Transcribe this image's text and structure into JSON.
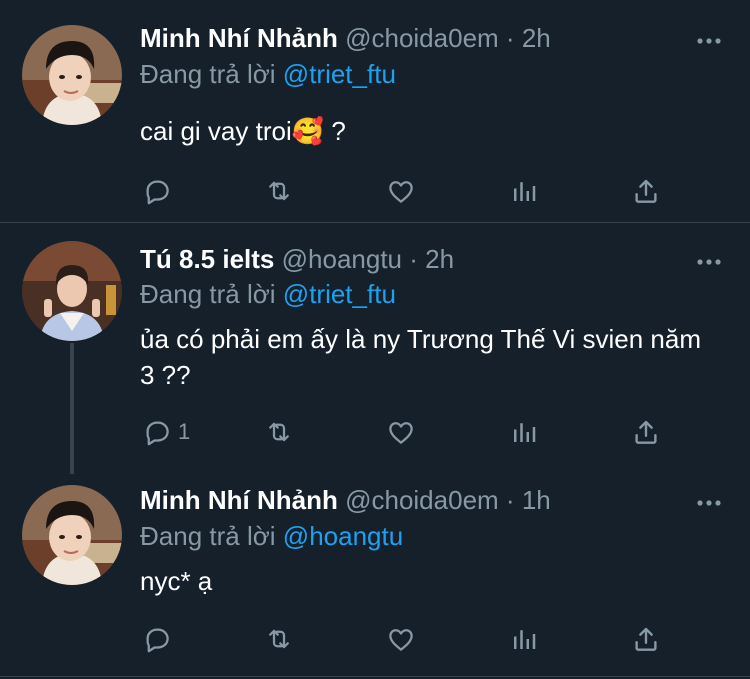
{
  "tweets": [
    {
      "name": "Minh Nhí Nhảnh",
      "handle": "@choida0em",
      "sep": "·",
      "time": "2h",
      "reply_prefix": "Đang trả lời",
      "reply_to": "@triet_ftu",
      "text": "cai gi vay troi🥰 ?",
      "reply_count": ""
    },
    {
      "name": "Tú 8.5 ielts",
      "handle": "@hoangtu",
      "sep": "·",
      "time": "2h",
      "reply_prefix": "Đang trả lời",
      "reply_to": "@triet_ftu",
      "text": "ủa có phải em ấy là ny Trương Thế Vi svien năm 3 ??",
      "reply_count": "1"
    },
    {
      "name": "Minh Nhí Nhảnh",
      "handle": "@choida0em",
      "sep": "·",
      "time": "1h",
      "reply_prefix": "Đang trả lời",
      "reply_to": "@hoangtu",
      "text": "nyc* ạ",
      "reply_count": ""
    }
  ],
  "icons": {
    "reply": "speech-bubble-icon",
    "retweet": "retweet-icon",
    "like": "heart-icon",
    "views": "bar-chart-icon",
    "share": "share-upload-icon",
    "more": "more-dots-icon"
  },
  "colors": {
    "background": "#15202b",
    "divider": "#38444d",
    "muted": "#8899a6",
    "link": "#1da1f2",
    "text": "#ffffff"
  }
}
